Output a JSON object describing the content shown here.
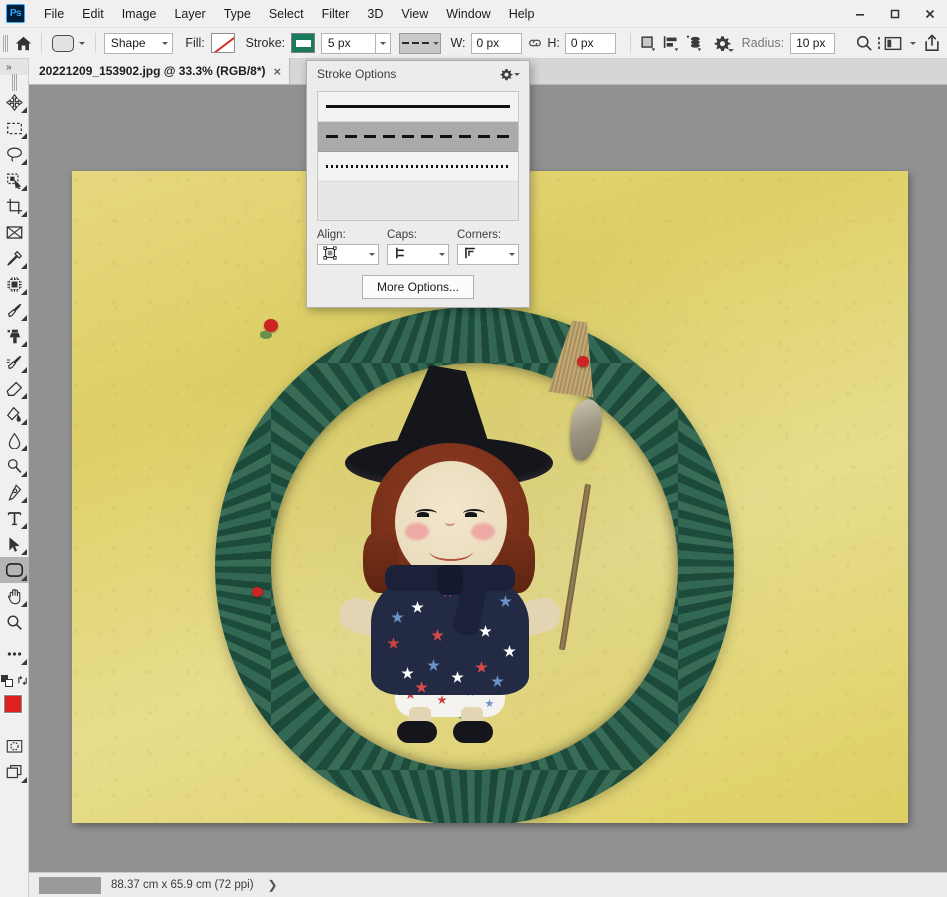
{
  "window": {
    "minimize_label": "Minimize",
    "maximize_label": "Maximize",
    "close_label": "Close",
    "app_logo_text": "Ps"
  },
  "menubar": {
    "items": [
      {
        "label": "File"
      },
      {
        "label": "Edit"
      },
      {
        "label": "Image"
      },
      {
        "label": "Layer"
      },
      {
        "label": "Type"
      },
      {
        "label": "Select"
      },
      {
        "label": "Filter"
      },
      {
        "label": "3D"
      },
      {
        "label": "View"
      },
      {
        "label": "Window"
      },
      {
        "label": "Help"
      }
    ]
  },
  "options_bar": {
    "home_label": "Home",
    "tool_preset_label": "Rounded Rectangle Tool",
    "mode_select": "Shape",
    "fill_label": "Fill:",
    "fill_value": "No Fill",
    "stroke_label": "Stroke:",
    "stroke_color": "#1a7a5e",
    "stroke_width": "5 px",
    "stroke_style": "Dashed",
    "width_label": "W:",
    "width_value": "0 px",
    "link_label": "Link width and height",
    "height_label": "H:",
    "height_value": "0 px",
    "path_operations_label": "Path operations",
    "path_alignment_label": "Path alignment",
    "path_arrangement_label": "Path arrangement",
    "path_settings_label": "Set additional shape and path options",
    "radius_label": "Radius:",
    "radius_value": "10 px",
    "align_edges_label": "Align Edges",
    "search_label": "Search",
    "workspace_label": "Workspace",
    "share_label": "Share"
  },
  "tabs": {
    "documents": [
      {
        "title": "20221209_153902.jpg @ 33.3% (RGB/8*)",
        "close_label": "×",
        "active": true
      }
    ]
  },
  "toolbar": {
    "collapse_label": "»",
    "tools": [
      {
        "name": "move-tool",
        "label": "Move Tool"
      },
      {
        "name": "marquee-tool",
        "label": "Rectangular Marquee Tool"
      },
      {
        "name": "lasso-tool",
        "label": "Lasso Tool"
      },
      {
        "name": "object-selection-tool",
        "label": "Object Selection Tool"
      },
      {
        "name": "crop-tool",
        "label": "Crop Tool"
      },
      {
        "name": "frame-tool",
        "label": "Frame Tool"
      },
      {
        "name": "eyedropper-tool",
        "label": "Eyedropper Tool"
      },
      {
        "name": "healing-brush-tool",
        "label": "Spot Healing Brush Tool"
      },
      {
        "name": "brush-tool",
        "label": "Brush Tool"
      },
      {
        "name": "clone-stamp-tool",
        "label": "Clone Stamp Tool"
      },
      {
        "name": "history-brush-tool",
        "label": "History Brush Tool"
      },
      {
        "name": "eraser-tool",
        "label": "Eraser Tool"
      },
      {
        "name": "gradient-tool",
        "label": "Gradient Tool"
      },
      {
        "name": "blur-tool",
        "label": "Blur Tool"
      },
      {
        "name": "dodge-tool",
        "label": "Dodge Tool"
      },
      {
        "name": "pen-tool",
        "label": "Pen Tool"
      },
      {
        "name": "type-tool",
        "label": "Horizontal Type Tool"
      },
      {
        "name": "path-selection-tool",
        "label": "Path Selection Tool"
      },
      {
        "name": "rounded-rectangle-tool",
        "label": "Rounded Rectangle Tool",
        "active": true
      },
      {
        "name": "hand-tool",
        "label": "Hand Tool"
      },
      {
        "name": "zoom-tool",
        "label": "Zoom Tool"
      },
      {
        "name": "edit-toolbar",
        "label": "Edit Toolbar"
      }
    ],
    "swap_colors_label": "Switch Foreground and Background Colors",
    "default_colors_label": "Default Foreground and Background Colors",
    "foreground_color": "#e01f1f",
    "background_color": "#ffffff",
    "quick_mask_label": "Edit in Quick Mask Mode",
    "screen_mode_label": "Change Screen Mode"
  },
  "stroke_options_popup": {
    "title": "Stroke Options",
    "gear_label": "Stroke options menu",
    "presets": [
      {
        "name": "solid",
        "label": "Solid line",
        "selected": false
      },
      {
        "name": "dashed",
        "label": "Dashed line",
        "selected": true
      },
      {
        "name": "dotted",
        "label": "Dotted line",
        "selected": false
      }
    ],
    "align_label": "Align:",
    "align_value": "Center",
    "caps_label": "Caps:",
    "caps_value": "Butt",
    "corners_label": "Corners:",
    "corners_value": "Miter",
    "more_options_label": "More Options..."
  },
  "status_bar": {
    "zoom_value": "",
    "document_info": "88.37 cm x 65.9 cm (72 ppi)",
    "expand_label": "❯"
  },
  "canvas": {
    "image_description": "Handmade witch rag doll sitting on a green grapevine wreath against a yellow background",
    "background_color": "#919191",
    "paper_color": "#ded066"
  }
}
